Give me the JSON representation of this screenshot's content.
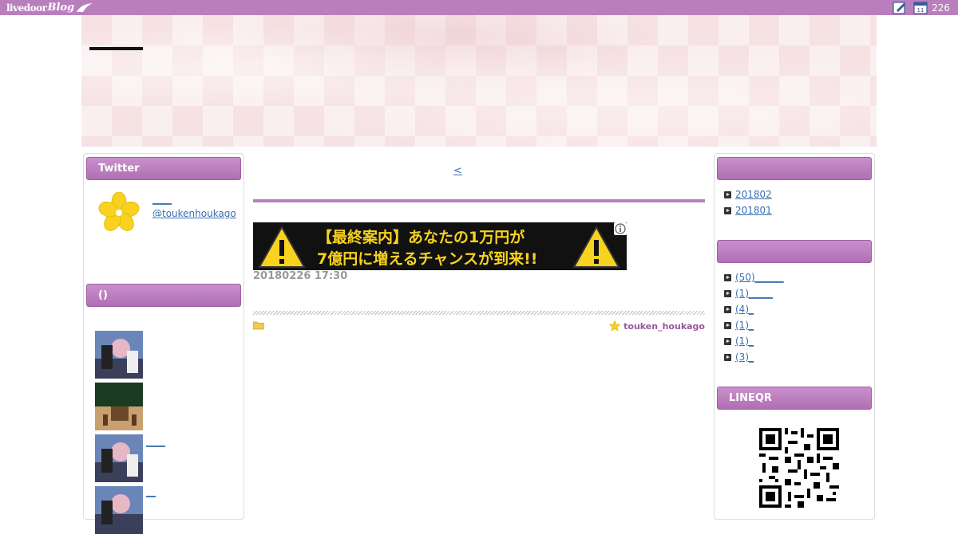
{
  "topbar": {
    "logo_main": "livedoor",
    "logo_sub": "Blog",
    "calendar_day": "11",
    "count": "226"
  },
  "sidebar_left": {
    "twitter_title": "Twitter",
    "twitter_name": "____",
    "twitter_handle": "@toukenhoukago",
    "recent_title": "()",
    "recent_links": [
      "",
      "",
      "____",
      "__"
    ]
  },
  "main": {
    "prev_link": "<",
    "ad_line1": "【最終案内】あなたの1万円が",
    "ad_line2": "7億円に増えるチャンスが到来!!",
    "post_date": "20180226 17:30",
    "author": "touken_houkago"
  },
  "sidebar_right": {
    "archive_title": "",
    "archives": [
      "201802",
      "201801"
    ],
    "category_title": "",
    "categories": [
      " (50)______",
      " (1)_____",
      " (4)_",
      " (1)_",
      " (1)_",
      " (3)_"
    ],
    "qr_title": "LINEQR"
  },
  "colors": {
    "accent": "#b97fbd",
    "link": "#3a6fb0",
    "banner": "#f6e1e3"
  }
}
